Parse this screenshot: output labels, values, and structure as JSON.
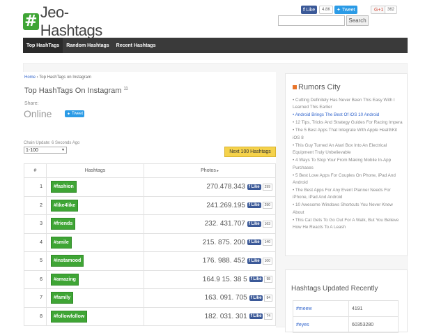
{
  "header": {
    "logo_glyph": "#",
    "logo_text": "Jeo-Hashtags",
    "fb_like": "Like",
    "fb_like_count": "4.8K",
    "tweet": "Tweet",
    "gplus": "G+1",
    "gplus_count": "362",
    "search_placeholder": "",
    "search_button": "Search"
  },
  "nav": {
    "items": [
      {
        "label": "Top HashTags"
      },
      {
        "label": "Random Hashtags"
      },
      {
        "label": "Recent Hashtags"
      }
    ]
  },
  "breadcrumb": {
    "home": "Home",
    "sep": " › ",
    "current": "Top HashTags on Instagram"
  },
  "page": {
    "title": "Top HashTags On Instagram",
    "title_sup": "11",
    "share_label": "Share:",
    "share_status": "Online",
    "tweet": "Tweet",
    "update_label": "Chain Update: 6 Seconds Ago",
    "range_selected": "1-100",
    "next_button": "Next 100 Hashtags"
  },
  "table": {
    "headers": [
      "#",
      "Hashtags",
      "Photos"
    ],
    "like_label": "Like",
    "rows": [
      {
        "rank": "1",
        "tag": "#fashion",
        "photos": "270.478.343",
        "likes": "299"
      },
      {
        "rank": "2",
        "tag": "#like4like",
        "photos": "241.269.195",
        "likes": "290"
      },
      {
        "rank": "3",
        "tag": "#friends",
        "photos": "232. 431.707",
        "likes": "163"
      },
      {
        "rank": "4",
        "tag": "#smile",
        "photos": "215. 875. 200",
        "likes": "140"
      },
      {
        "rank": "5",
        "tag": "#instamood",
        "photos": "176. 988. 452",
        "likes": "100"
      },
      {
        "rank": "6",
        "tag": "#amazing",
        "photos": "164.9 15. 38 5",
        "likes": "98"
      },
      {
        "rank": "7",
        "tag": "#family",
        "photos": "163. 091. 705",
        "likes": "84"
      },
      {
        "rank": "8",
        "tag": "#followfollow",
        "photos": "182. 031. 301",
        "likes": "74"
      }
    ]
  },
  "sidebar": {
    "rumors_title": "Rumors City",
    "rumors": [
      {
        "text": "Cutting Definitely Has Never Been This Easy With I Learned This Earlier",
        "blue": false
      },
      {
        "text": "Android Brings The Best Of iOS 10 Android",
        "blue": true
      },
      {
        "text": "12 Tips, Tricks And Strategy Guides For Racing Impera",
        "blue": false
      },
      {
        "text": "The 5 Best Apps That Integrate With Apple HealthKit iOS 8",
        "blue": false
      },
      {
        "text": "This Guy Turned An Atari Box Into An Electrical Equipment Truly Unbelievable",
        "blue": false
      },
      {
        "text": "4 Ways To Stop Your From Making Mobile In-App Purchases",
        "blue": false
      },
      {
        "text": "5 Best Love Apps For Couples On Phone, iPad And Android",
        "blue": false
      },
      {
        "text": "The Best Apps For Any Event Planner Needs For iPhone, iPad And Android",
        "blue": false
      },
      {
        "text": "10 Awesome Windows Shortcuts You Never Knew About",
        "blue": false
      },
      {
        "text": "This Cat Gets To Go Out For A Walk, But You Believe How He Reacts To A Leash",
        "blue": false
      }
    ],
    "updated_title": "Hashtags Updated Recently",
    "updated": [
      {
        "tag": "#meew",
        "value": "4191"
      },
      {
        "tag": "#eyes",
        "value": "60353280"
      }
    ]
  }
}
